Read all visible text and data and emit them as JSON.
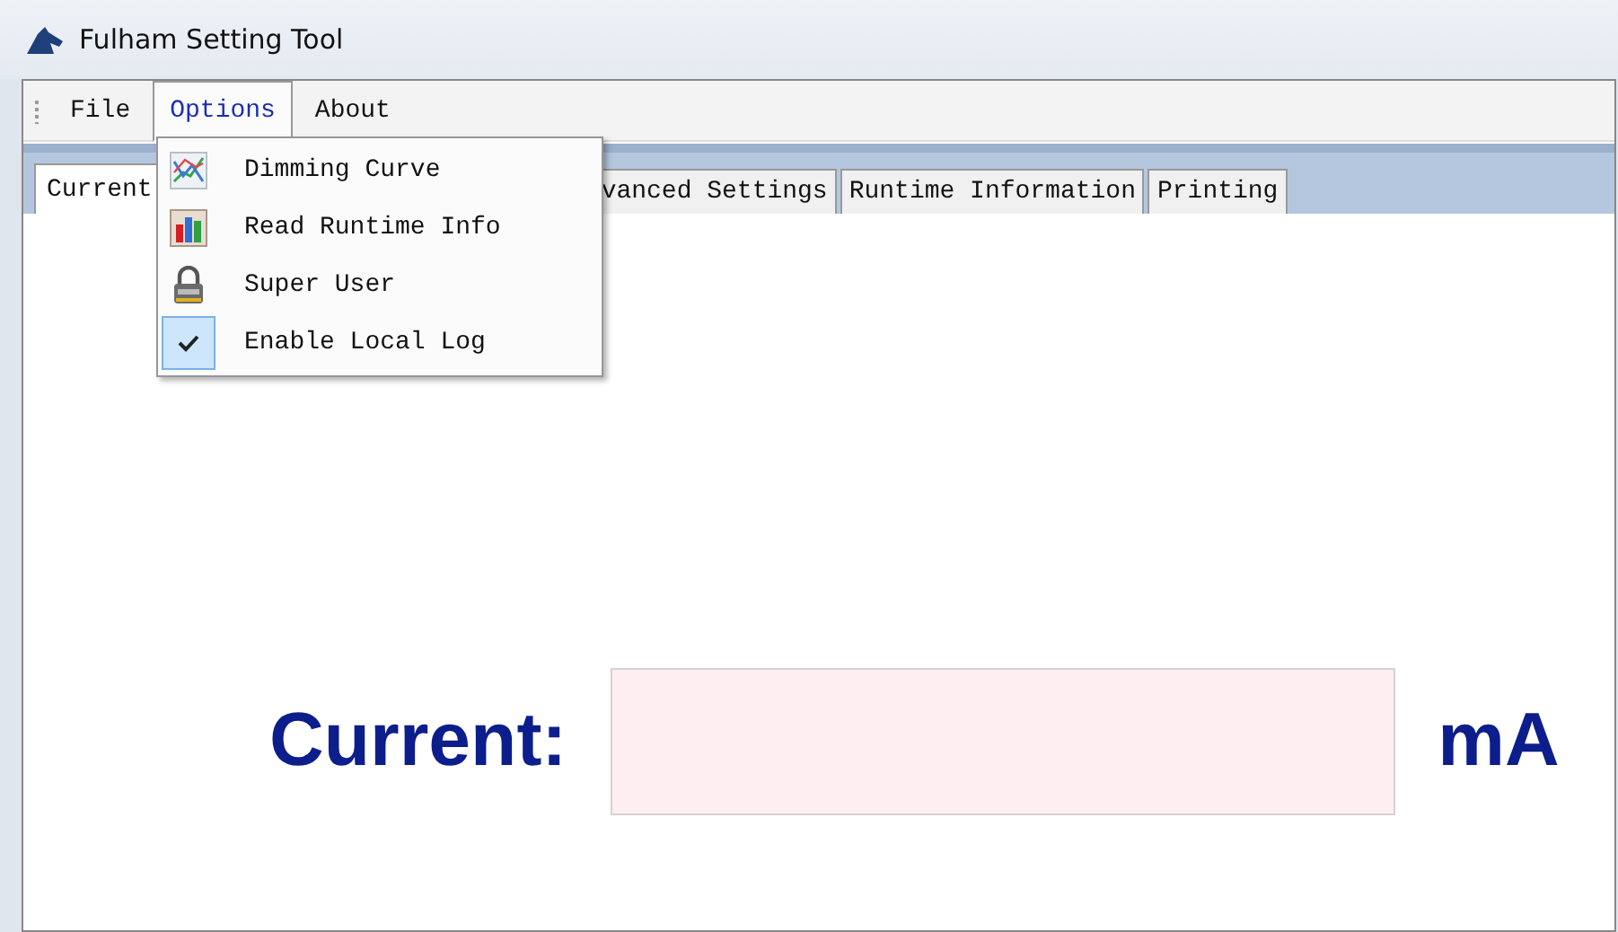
{
  "window": {
    "title": "Fulham Setting Tool"
  },
  "menu_bar": [
    {
      "label": "File",
      "selected": false
    },
    {
      "label": "Options",
      "selected": true
    },
    {
      "label": "About",
      "selected": false
    }
  ],
  "options_menu": [
    {
      "label": "Dimming Curve",
      "kind": "curve",
      "checked": false
    },
    {
      "label": "Read Runtime Info",
      "kind": "bars",
      "checked": false
    },
    {
      "label": "Super User",
      "kind": "lock",
      "checked": false
    },
    {
      "label": "Enable Local Log",
      "kind": "check",
      "checked": true
    }
  ],
  "tabs": [
    {
      "label": "Current",
      "selected": true
    },
    {
      "label": "vanced Settings",
      "selected": false
    },
    {
      "label": "Runtime Information",
      "selected": false
    },
    {
      "label": "Printing",
      "selected": false
    }
  ],
  "current_form": {
    "label": "Current:",
    "unit": "mA"
  }
}
